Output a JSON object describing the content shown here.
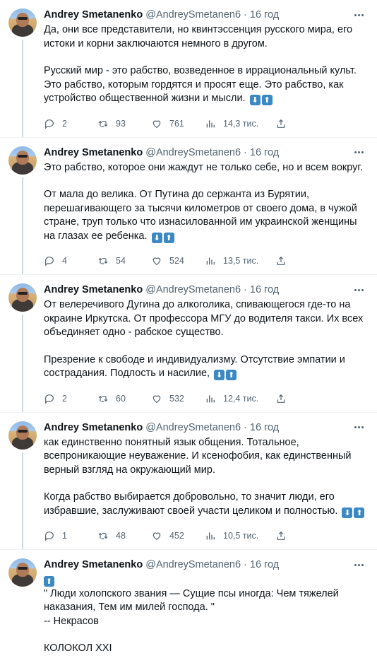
{
  "tweets": [
    {
      "author": "Andrey Smetanenko",
      "handle": "@AndreySmetanen6",
      "separator": "·",
      "time": "16 год",
      "paragraphs": [
        "Да, они все представители, но квинтэссенция русского мира, его истоки и корни заключаются немного в другом.",
        "Русский мир - это рабство, возведенное в иррациональный культ. Это рабство, которым гордятся и просят еще. Это рабство, как устройство общественной жизни и мысли."
      ],
      "emoji": [
        "⬇",
        "⬆"
      ],
      "replies": "2",
      "retweets": "93",
      "likes": "761",
      "views": "14,3 тис."
    },
    {
      "author": "Andrey Smetanenko",
      "handle": "@AndreySmetanen6",
      "separator": "·",
      "time": "16 год",
      "paragraphs": [
        "Это рабство, которое они жаждут не только себе, но и всем вокруг.",
        "От мала до велика. От Путина до сержанта из Бурятии, перешагивающего за тысячи километров от своего дома, в чужой стране, труп только что изнасилованной им украинской женщины на глазах ее ребенка."
      ],
      "emoji": [
        "⬇",
        "⬆"
      ],
      "replies": "4",
      "retweets": "54",
      "likes": "524",
      "views": "13,5 тис."
    },
    {
      "author": "Andrey Smetanenko",
      "handle": "@AndreySmetanen6",
      "separator": "·",
      "time": "16 год",
      "paragraphs": [
        "От велеречивого Дугина до алкоголика, спивающегося где-то на окраине Иркутска. От профессора МГУ до водителя такси. Их всех объединяет одно - рабское существо.",
        "Презрение к свободе и индивидуализму. Отсутствие эмпатии и сострадания. Подлость и насилие,"
      ],
      "emoji": [
        "⬇",
        "⬆"
      ],
      "replies": "2",
      "retweets": "60",
      "likes": "532",
      "views": "12,4 тис."
    },
    {
      "author": "Andrey Smetanenko",
      "handle": "@AndreySmetanen6",
      "separator": "·",
      "time": "16 год",
      "paragraphs": [
        "как единственно понятный язык общения. Тотальное, всепроникающие неуважение. И ксенофобия, как единственный верный взгляд на окружающий мир.",
        "Когда рабство выбирается добровольно, то значит люди, его избравшие, заслуживают своей участи целиком и полностью."
      ],
      "emoji": [
        "⬇",
        "⬆"
      ],
      "replies": "1",
      "retweets": "48",
      "likes": "452",
      "views": "10,5 тис."
    },
    {
      "author": "Andrey Smetanenko",
      "handle": "@AndreySmetanen6",
      "separator": "·",
      "time": "16 год",
      "emoji": [
        "⬆"
      ],
      "quote": "\" Люди холопского звания — Сущие псы иногда: Чем тяжелей наказания, Тем им милей господа. \"",
      "attribution": "-- Некрасов",
      "closing": "КОЛОКОЛ XXI"
    }
  ],
  "icons": {
    "reply": "reply-icon",
    "retweet": "retweet-icon",
    "like": "like-icon",
    "views": "views-icon",
    "share": "share-icon",
    "more": "more-icon"
  },
  "colors": {
    "text": "#0f1419",
    "secondary": "#536471",
    "emoji": "#3b88c3",
    "connector": "#cfd9de"
  }
}
